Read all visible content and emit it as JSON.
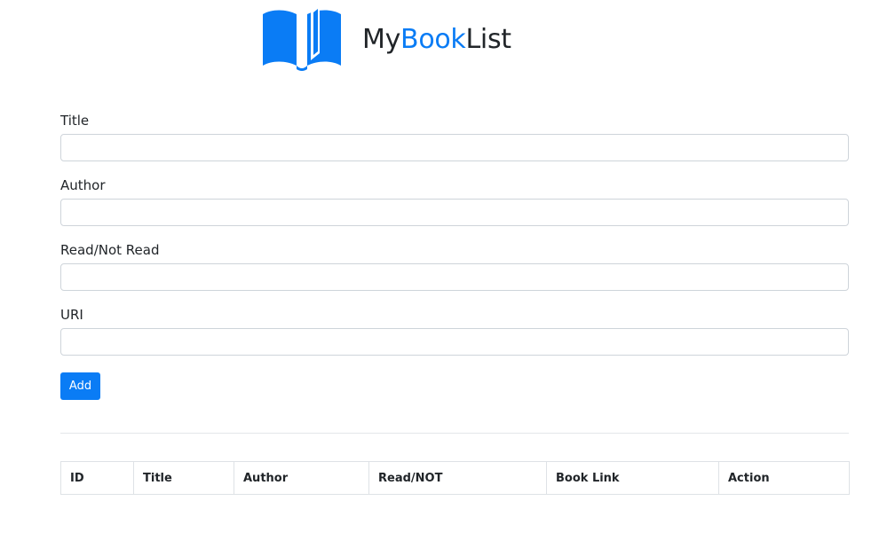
{
  "brand": {
    "name_part1": "My",
    "name_part2": "Book",
    "name_part3": "List",
    "logo_icon": "open-book-icon",
    "accent_color": "#0a7cf5"
  },
  "form": {
    "title_label": "Title",
    "title_value": "",
    "author_label": "Author",
    "author_value": "",
    "read_label": "Read/Not Read",
    "read_value": "",
    "uri_label": "URI",
    "uri_value": "",
    "add_button_label": "Add"
  },
  "table": {
    "headers": [
      "ID",
      "Title",
      "Author",
      "Read/NOT",
      "Book Link",
      "Action"
    ],
    "rows": []
  }
}
